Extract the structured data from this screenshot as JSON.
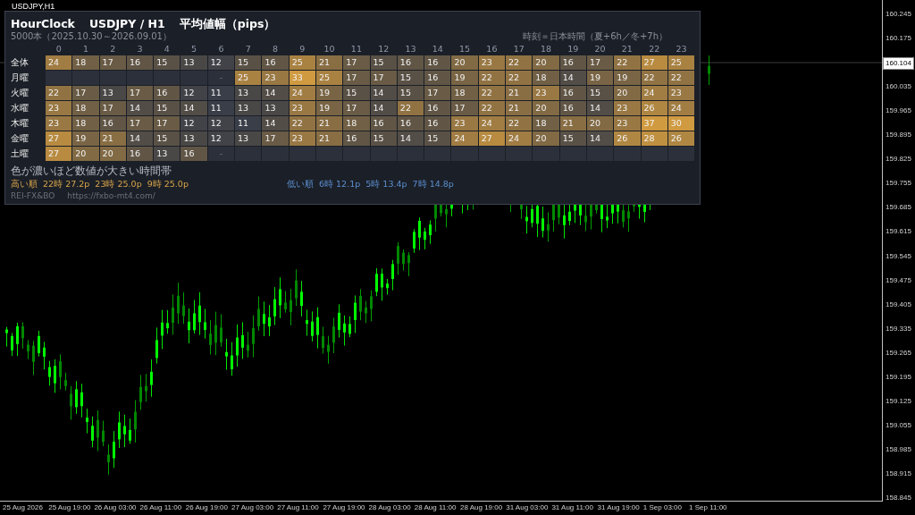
{
  "chart_window": {
    "title": "USDJPY,H1",
    "current_price": "160.104",
    "price_axis": [
      "160.245",
      "160.175",
      "160.035",
      "159.965",
      "159.895",
      "159.825",
      "159.755",
      "159.685",
      "159.615",
      "159.545",
      "159.475",
      "159.405",
      "159.335",
      "159.265",
      "159.195",
      "159.125",
      "159.055",
      "158.985",
      "158.915",
      "158.845"
    ],
    "time_axis": [
      "25 Aug 2026",
      "25 Aug 19:00",
      "26 Aug 03:00",
      "26 Aug 11:00",
      "26 Aug 19:00",
      "27 Aug 03:00",
      "27 Aug 11:00",
      "27 Aug 19:00",
      "28 Aug 03:00",
      "28 Aug 11:00",
      "28 Aug 19:00",
      "31 Aug 03:00",
      "31 Aug 11:00",
      "31 Aug 19:00",
      "1 Sep 03:00",
      "1 Sep 11:00"
    ]
  },
  "panel": {
    "app_name": "HourClock",
    "symbol": "USDJPY / H1",
    "metric": "平均値幅（pips）",
    "bars_info": "5000本（2025.10.30～2026.09.01）",
    "timezone_note": "時刻＝日本時間（夏+6h／冬+7h）",
    "hours": [
      "0",
      "1",
      "2",
      "3",
      "4",
      "5",
      "6",
      "7",
      "8",
      "9",
      "10",
      "11",
      "12",
      "13",
      "14",
      "15",
      "16",
      "17",
      "18",
      "19",
      "20",
      "21",
      "22",
      "23"
    ],
    "rows": [
      {
        "label": "全体",
        "cells": [
          "24",
          "18",
          "17",
          "16",
          "15",
          "13",
          "12",
          "15",
          "16",
          "25",
          "21",
          "17",
          "15",
          "16",
          "16",
          "20",
          "23",
          "22",
          "20",
          "16",
          "17",
          "22",
          "27",
          "25"
        ]
      },
      {
        "label": "月曜",
        "cells": [
          null,
          null,
          null,
          null,
          null,
          null,
          "-",
          "25",
          "23",
          "33",
          "25",
          "17",
          "17",
          "15",
          "16",
          "19",
          "22",
          "22",
          "18",
          "14",
          "19",
          "19",
          "22",
          "22"
        ]
      },
      {
        "label": "火曜",
        "cells": [
          "22",
          "17",
          "13",
          "17",
          "16",
          "12",
          "11",
          "13",
          "14",
          "24",
          "19",
          "15",
          "14",
          "15",
          "17",
          "18",
          "22",
          "21",
          "23",
          "16",
          "15",
          "20",
          "24",
          "23"
        ]
      },
      {
        "label": "水曜",
        "cells": [
          "23",
          "18",
          "17",
          "14",
          "15",
          "14",
          "11",
          "13",
          "13",
          "23",
          "19",
          "17",
          "14",
          "22",
          "16",
          "17",
          "22",
          "21",
          "20",
          "16",
          "14",
          "23",
          "26",
          "24"
        ]
      },
      {
        "label": "木曜",
        "cells": [
          "23",
          "18",
          "16",
          "17",
          "17",
          "12",
          "12",
          "11",
          "14",
          "22",
          "21",
          "18",
          "16",
          "16",
          "16",
          "23",
          "24",
          "22",
          "18",
          "21",
          "20",
          "23",
          "37",
          "30"
        ]
      },
      {
        "label": "金曜",
        "cells": [
          "27",
          "19",
          "21",
          "14",
          "15",
          "13",
          "12",
          "13",
          "17",
          "23",
          "21",
          "16",
          "15",
          "14",
          "15",
          "24",
          "27",
          "24",
          "20",
          "15",
          "14",
          "26",
          "28",
          "26"
        ]
      },
      {
        "label": "土曜",
        "cells": [
          "27",
          "20",
          "20",
          "16",
          "13",
          "16",
          "-",
          null,
          null,
          null,
          null,
          null,
          null,
          null,
          null,
          null,
          null,
          null,
          null,
          null,
          null,
          null,
          null,
          null
        ]
      }
    ],
    "legend": "色が濃いほど数値が大きい時間帯",
    "highest": "高い順  22時 27.2p  23時 25.0p  9時 25.0p",
    "lowest": "低い順  6時 12.1p  5時 13.4p  7時 14.8p",
    "credit": "REI-FX&BO",
    "url": "https://fxbo-mt4.com/"
  }
}
